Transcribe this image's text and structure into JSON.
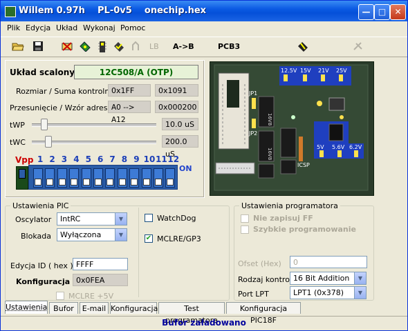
{
  "window": {
    "title": "Willem 0.97h    PL-0v5    onechip.hex",
    "btn_min": "—",
    "btn_max": "□",
    "btn_close": "✕"
  },
  "menu": [
    "Plik",
    "Edycja",
    "Układ",
    "Wykonaj",
    "Pomoc"
  ],
  "toolbar": {
    "lb": "LB",
    "ab": "A->B",
    "pcb": "PCB3"
  },
  "chip": {
    "label": "Układ scalony :",
    "name": "12C508/A  (OTP)",
    "size_label": "Rozmiar / Suma kontrolna",
    "size": "0x1FF",
    "checksum": "0x1091",
    "shift_label": "Przesunięcie / Wzór adresu",
    "shift": "A0 --> A12",
    "pattern": "0x000200",
    "twp_label": "tWP",
    "twp": "10.0 uS",
    "twc_label": "tWC",
    "twc": "200.0 uS"
  },
  "dip": {
    "vpp": "Vpp",
    "numbers": [
      "1",
      "2",
      "3",
      "4",
      "5",
      "6",
      "7",
      "8",
      "9",
      "10",
      "11",
      "12"
    ],
    "on": "ON"
  },
  "pcb": {
    "voltages_top": [
      "12.5V",
      "15V",
      "21V",
      "25V"
    ],
    "voltages_bottom": [
      "5V",
      "5.6V",
      "6.2V"
    ],
    "jp1": "JP1",
    "jp2": "JP2",
    "icsp": "ICSP",
    "chip_label1": "16V8",
    "chip_label2": "16V8"
  },
  "pic": {
    "group_title": "Ustawienia PIC",
    "osc_label": "Oscylator",
    "osc_value": "IntRC",
    "lock_label": "Blokada",
    "lock_value": "Wyłączona",
    "watchdog": "WatchDog",
    "mclre": "MCLRE/GP3",
    "id_label": "Edycja ID ( hex )",
    "id_value": "FFFF",
    "config_label": "Konfiguracja",
    "config_value": "0x0FEA",
    "mclre5": "MCLRE +5V"
  },
  "programmer": {
    "group_title": "Ustawienia programatora",
    "no_write_ff": "Nie zapisuj FF",
    "fast_prog": "Szybkie programowanie",
    "offset_label": "Ofset (Hex)",
    "offset_value": "0",
    "control_label": "Rodzaj kontroli",
    "control_value": "16 Bit Addition",
    "port_label": "Port LPT",
    "port_value": "LPT1 (0x378)"
  },
  "tabs": [
    "Ustawienia",
    "Bufor",
    "E-mail",
    "Konfiguracja",
    "Test programatora",
    "Konfiguracja PIC18F"
  ],
  "status": "Bufor załadowano"
}
